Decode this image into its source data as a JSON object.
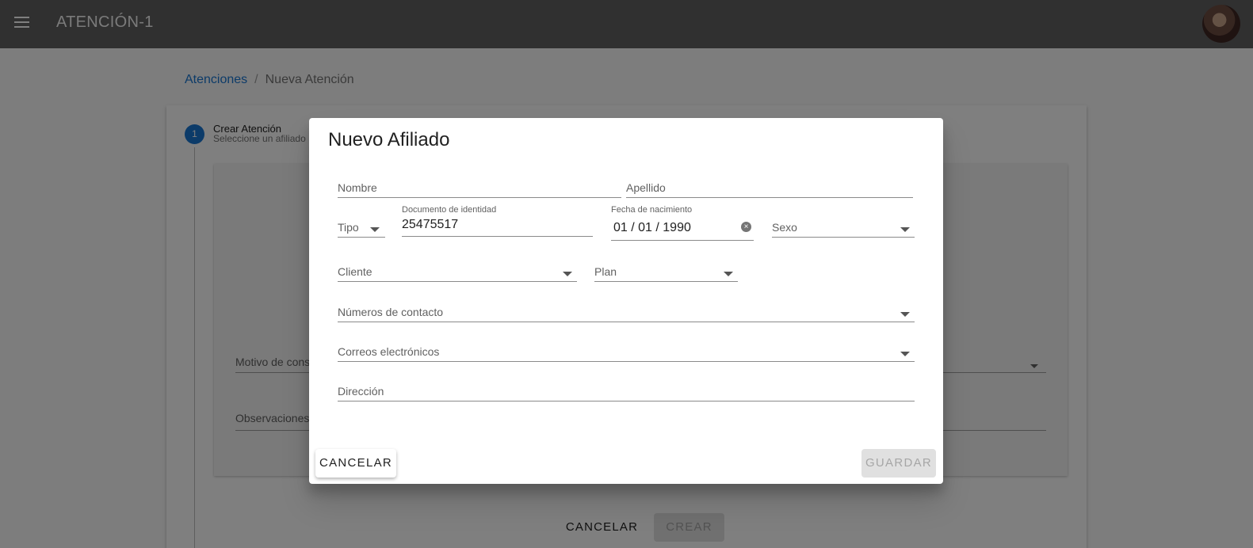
{
  "appbar": {
    "title": "ATENCIÓN-1"
  },
  "breadcrumb": {
    "link": "Atenciones",
    "separator": "/",
    "current": "Nueva Atención"
  },
  "stepper": {
    "number": "1",
    "title": "Crear Atención",
    "subtitle": "Seleccione un afiliado"
  },
  "background_form": {
    "motivo_label": "Motivo de consulta",
    "observaciones_label": "Observaciones",
    "cancel_label": "CANCELAR",
    "create_label": "CREAR"
  },
  "dialog": {
    "title": "Nuevo Afiliado",
    "fields": {
      "nombre": {
        "label": "Nombre"
      },
      "apellido": {
        "label": "Apellido"
      },
      "tipo": {
        "label": "Tipo"
      },
      "documento": {
        "label": "Documento de identidad",
        "value": "25475517"
      },
      "fecha": {
        "label": "Fecha de nacimiento",
        "value": "01 / 01 / 1990"
      },
      "sexo": {
        "label": "Sexo"
      },
      "cliente": {
        "label": "Cliente"
      },
      "plan": {
        "label": "Plan"
      },
      "contactos": {
        "label": "Números de contacto"
      },
      "correos": {
        "label": "Correos electrónicos"
      },
      "direccion": {
        "label": "Dirección"
      }
    },
    "cancel_label": "CANCELAR",
    "save_label": "GUARDAR"
  },
  "colors": {
    "appbar": "#616161",
    "primary": "#1976d2",
    "disabled_button": "#e0e0e0"
  }
}
